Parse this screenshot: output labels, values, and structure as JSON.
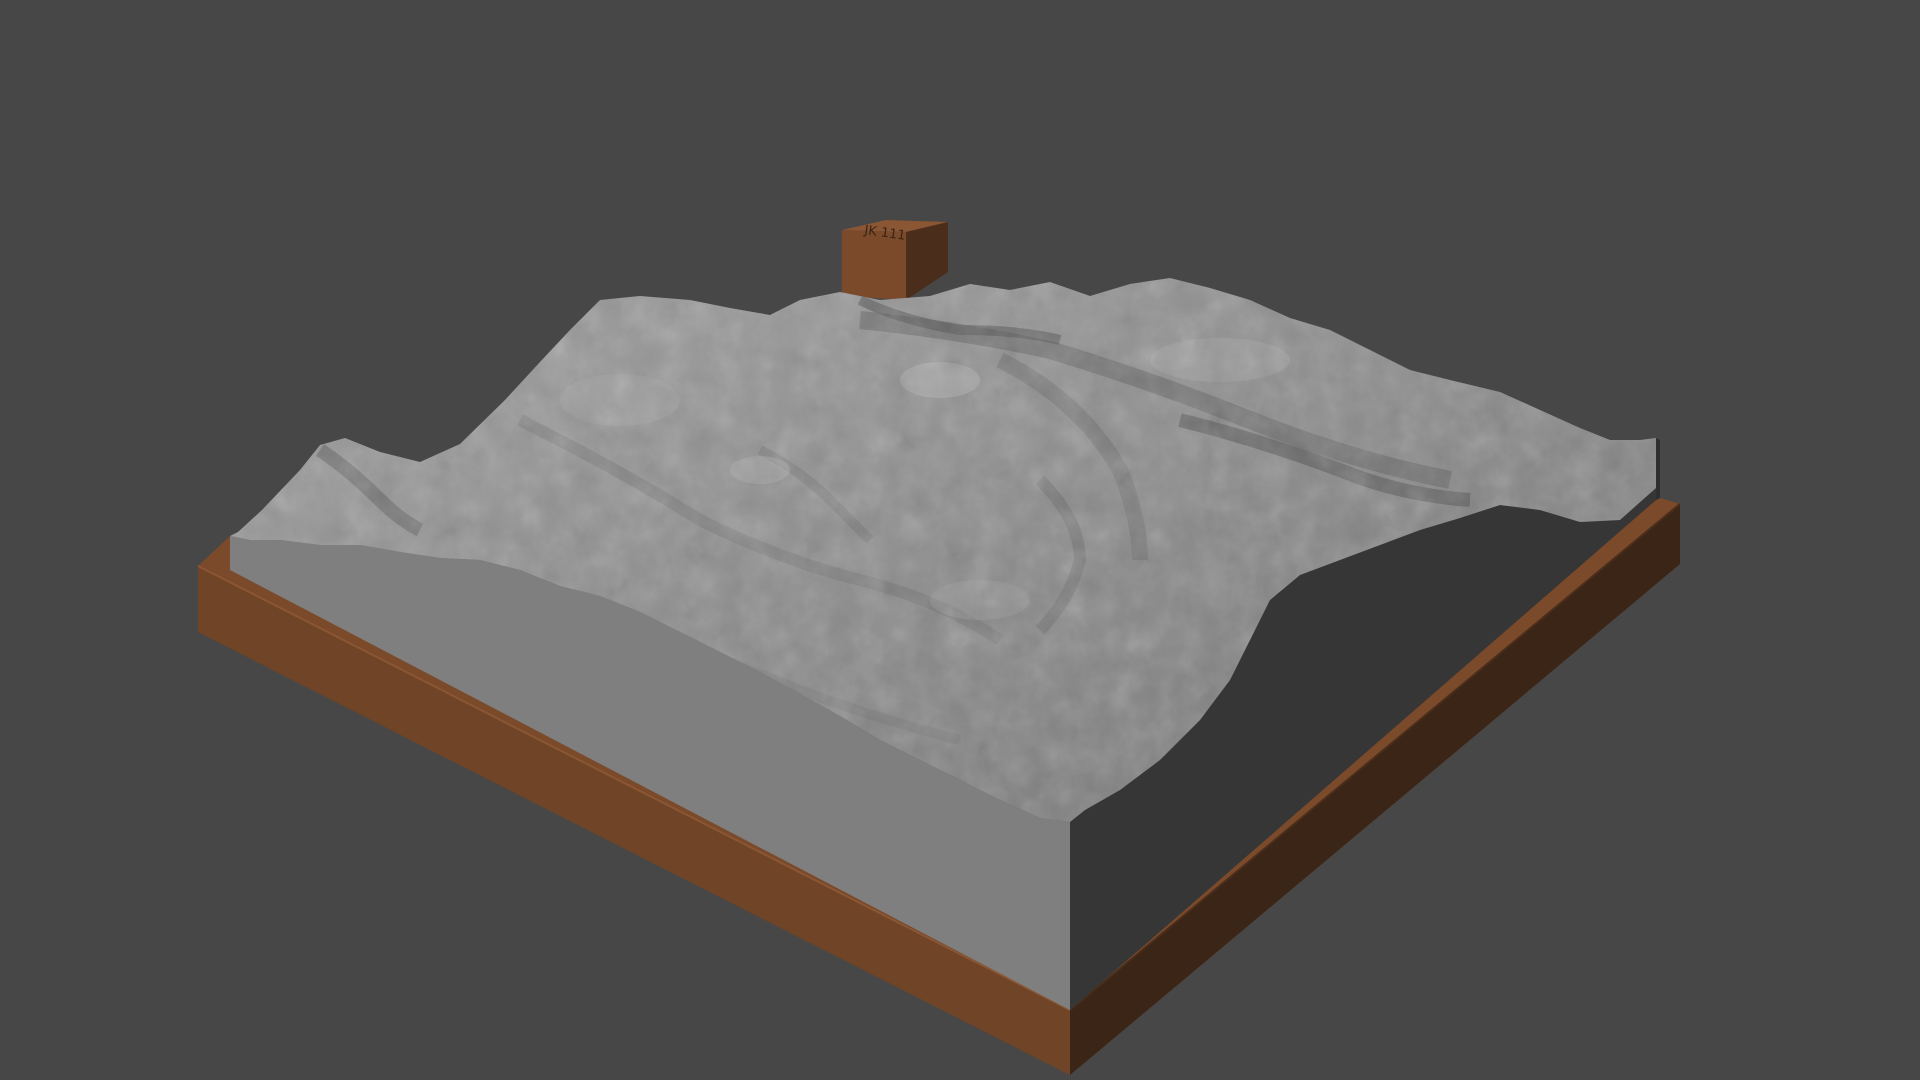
{
  "viewport": {
    "background": "#474747"
  },
  "scene": {
    "terrain": {
      "color_light": "#9c9c9c",
      "color_mid": "#8a8a8a",
      "color_dark": "#5e5e5e",
      "side_left": "#7e7e7e",
      "side_right": "#363636"
    },
    "base": {
      "color_front": "#6e4427",
      "color_right": "#3b2517",
      "color_top": "#7a4a2b"
    },
    "marker": {
      "color_front": "#7a4a2b",
      "color_top": "#8a5634",
      "color_side": "#4a2d1a",
      "engraving": "JK 111"
    }
  }
}
